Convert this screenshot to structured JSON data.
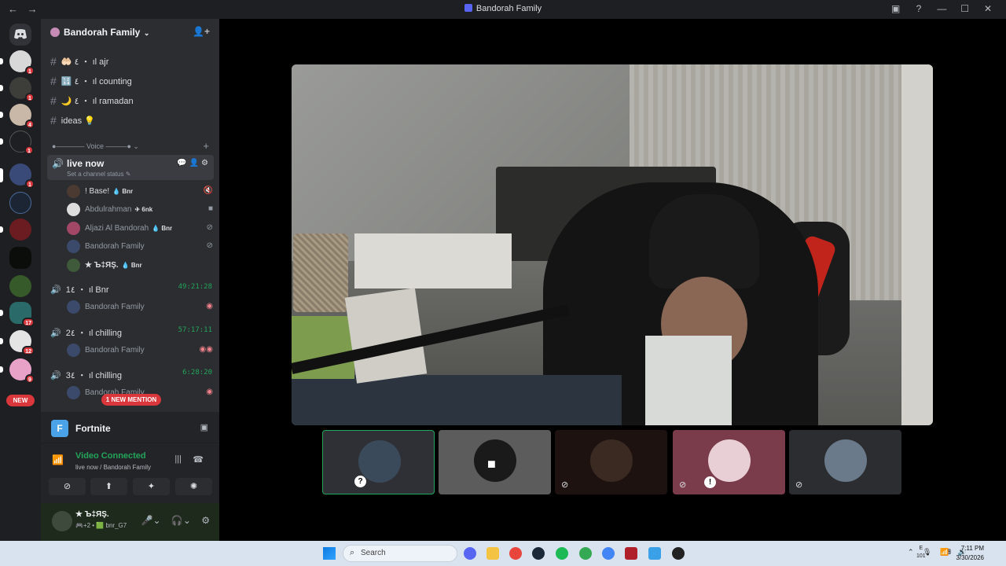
{
  "window": {
    "title": "Bandorah Family",
    "back_icon": "←",
    "forward_icon": "→"
  },
  "servers": {
    "badges": [
      "1",
      "1",
      "4",
      "1",
      "1",
      "",
      "",
      "",
      "",
      "17",
      "12",
      "9"
    ],
    "new_label": "NEW"
  },
  "server_header": {
    "name": "Bandorah Family"
  },
  "text_channels": [
    {
      "label": "ajr",
      "prefix": "🤲🏻 ٤ ・ ıl"
    },
    {
      "label": "counting",
      "prefix": "🔢 ٤ ・ ıl"
    },
    {
      "label": "ramadan",
      "prefix": "🌙 ٤ ・ ıl"
    },
    {
      "label": "ideas 💡",
      "prefix": ""
    }
  ],
  "voice_category": {
    "label": "Voice"
  },
  "live_channel": {
    "name": "live now",
    "status": "Set a channel status ✎"
  },
  "live_members": [
    {
      "name": "! Base!",
      "tag": "💧 Bnr"
    },
    {
      "name": "Abdulrahman",
      "tag": "✈ 6nk"
    },
    {
      "name": "Aljazi Al Bandorah",
      "tag": "💧 Bnr"
    },
    {
      "name": "Bandorah Family",
      "tag": ""
    },
    {
      "name": "★  Ъ‡ЯŞ.",
      "tag": "💧 Bnr"
    }
  ],
  "voice_channels": [
    {
      "name": "1٤ ・ ıl Bnr",
      "timer": "49:21:28",
      "member": "Bandorah Family"
    },
    {
      "name": "2٤ ・ ıl chilling",
      "timer": "57:17:11",
      "member": "Bandorah Family"
    },
    {
      "name": "3٤ ・ ıl chilling",
      "timer": "6:28:20",
      "member": "Bandorah Family"
    }
  ],
  "mention_pill": "1 NEW MENTION",
  "activity": {
    "game_name": "Fortnite",
    "game_icon": "F"
  },
  "connection": {
    "status": "Video Connected",
    "location": "live now / Bandorah Family"
  },
  "user": {
    "display_name": "★  Ъ‡ЯŞ.",
    "status": "🎮+2 • 🟩 bnr_G7"
  },
  "taskbar": {
    "search_placeholder": "Search",
    "time": "7:11 PM",
    "date": "3/30/2026",
    "kbd": "E",
    "kbd2": "101"
  },
  "colors": {
    "accent_green": "#23a55a",
    "mention_red": "#da373c",
    "blurple": "#5865f2"
  }
}
